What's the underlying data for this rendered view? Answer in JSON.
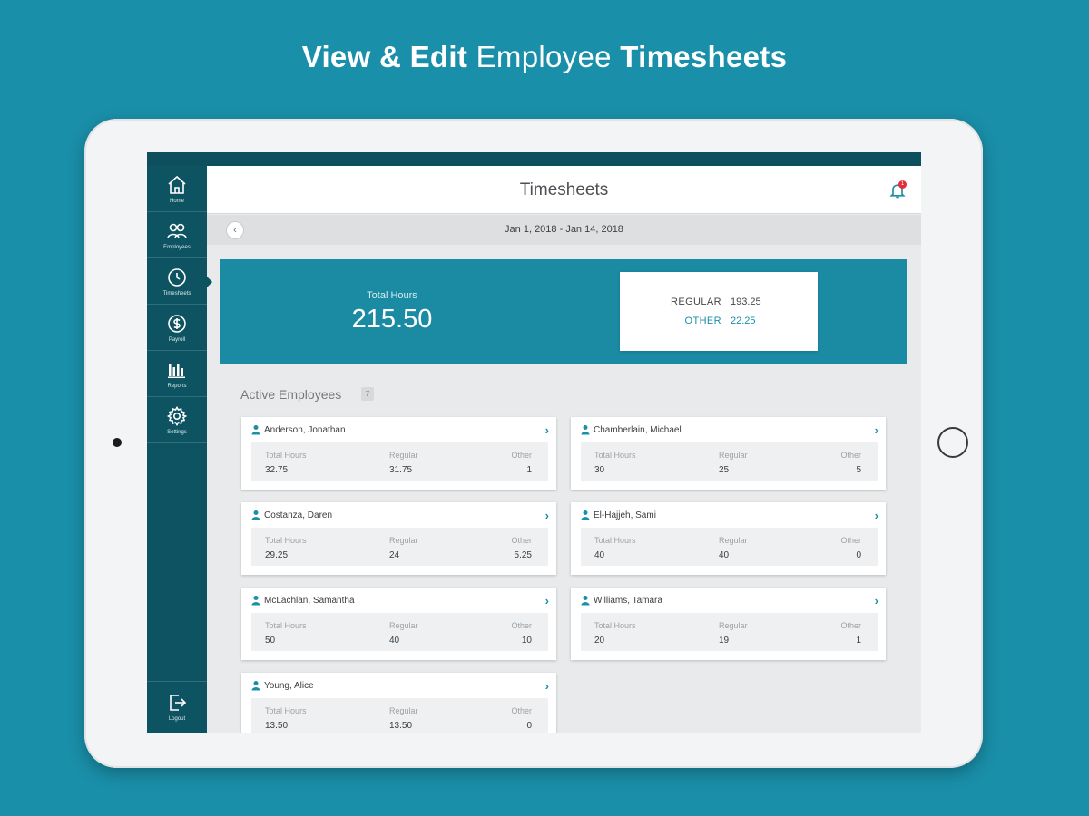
{
  "promo": {
    "part1": "View & Edit",
    "part2": "Employee",
    "part3": "Timesheets"
  },
  "sidebar": {
    "items": [
      {
        "label": "Home",
        "icon": "home-icon"
      },
      {
        "label": "Employees",
        "icon": "employees-icon"
      },
      {
        "label": "Timesheets",
        "icon": "clock-icon"
      },
      {
        "label": "Payroll",
        "icon": "dollar-icon"
      },
      {
        "label": "Reports",
        "icon": "bar-chart-icon"
      },
      {
        "label": "Settings",
        "icon": "gear-icon"
      }
    ],
    "active": "Timesheets",
    "logout": {
      "label": "Logout",
      "icon": "logout-icon"
    }
  },
  "header": {
    "title": "Timesheets",
    "notification_count": "1"
  },
  "date_range": "Jan 1, 2018 - Jan 14, 2018",
  "summary": {
    "total_label": "Total Hours",
    "total_value": "215.50",
    "regular_label": "REGULAR",
    "regular_value": "193.25",
    "other_label": "OTHER",
    "other_value": "22.25"
  },
  "employees_section": {
    "title": "Active Employees",
    "count": "7",
    "stat_labels": {
      "total": "Total Hours",
      "regular": "Regular",
      "other": "Other"
    }
  },
  "employees": [
    {
      "name": "Anderson, Jonathan",
      "total": "32.75",
      "regular": "31.75",
      "other": "1"
    },
    {
      "name": "Chamberlain, Michael",
      "total": "30",
      "regular": "25",
      "other": "5"
    },
    {
      "name": "Costanza, Daren",
      "total": "29.25",
      "regular": "24",
      "other": "5.25"
    },
    {
      "name": "El-Hajjeh, Sami",
      "total": "40",
      "regular": "40",
      "other": "0"
    },
    {
      "name": "McLachlan, Samantha",
      "total": "50",
      "regular": "40",
      "other": "10"
    },
    {
      "name": "Williams, Tamara",
      "total": "20",
      "regular": "19",
      "other": "1"
    },
    {
      "name": "Young, Alice",
      "total": "13.50",
      "regular": "13.50",
      "other": "0"
    }
  ],
  "colors": {
    "background": "#1a8fa9",
    "sidebar": "#0e5361",
    "accent": "#1b8aa3",
    "badge": "#e32d3a"
  }
}
